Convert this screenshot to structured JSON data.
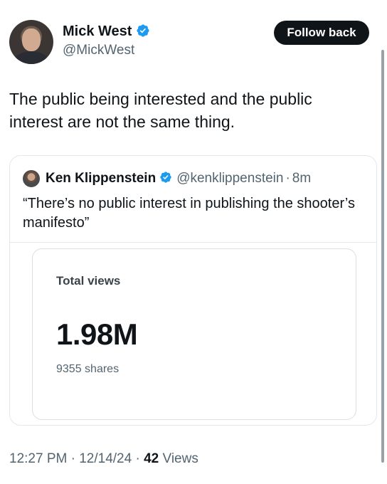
{
  "tweet": {
    "author": {
      "name": "Mick West",
      "handle": "@MickWest",
      "verified": true
    },
    "follow_label": "Follow back",
    "text": "The public being interested and the public interest are not the same thing.",
    "quote": {
      "author_name": "Ken Klippenstein",
      "handle": "@kenklippenstein",
      "separator": "·",
      "time": "8m",
      "text": "“There’s no public interest in publishing the shooter’s manifesto”",
      "views_card": {
        "label": "Total views",
        "value": "1.98M",
        "shares": "9355 shares"
      }
    },
    "meta": {
      "time": "12:27 PM",
      "sep1": "·",
      "date": "12/14/24",
      "sep2": "·",
      "views_count": "42",
      "views_label": "Views"
    }
  },
  "colors": {
    "verified_badge": "#1d9bf0",
    "primary_text": "#0f1419",
    "secondary_text": "#536471"
  }
}
